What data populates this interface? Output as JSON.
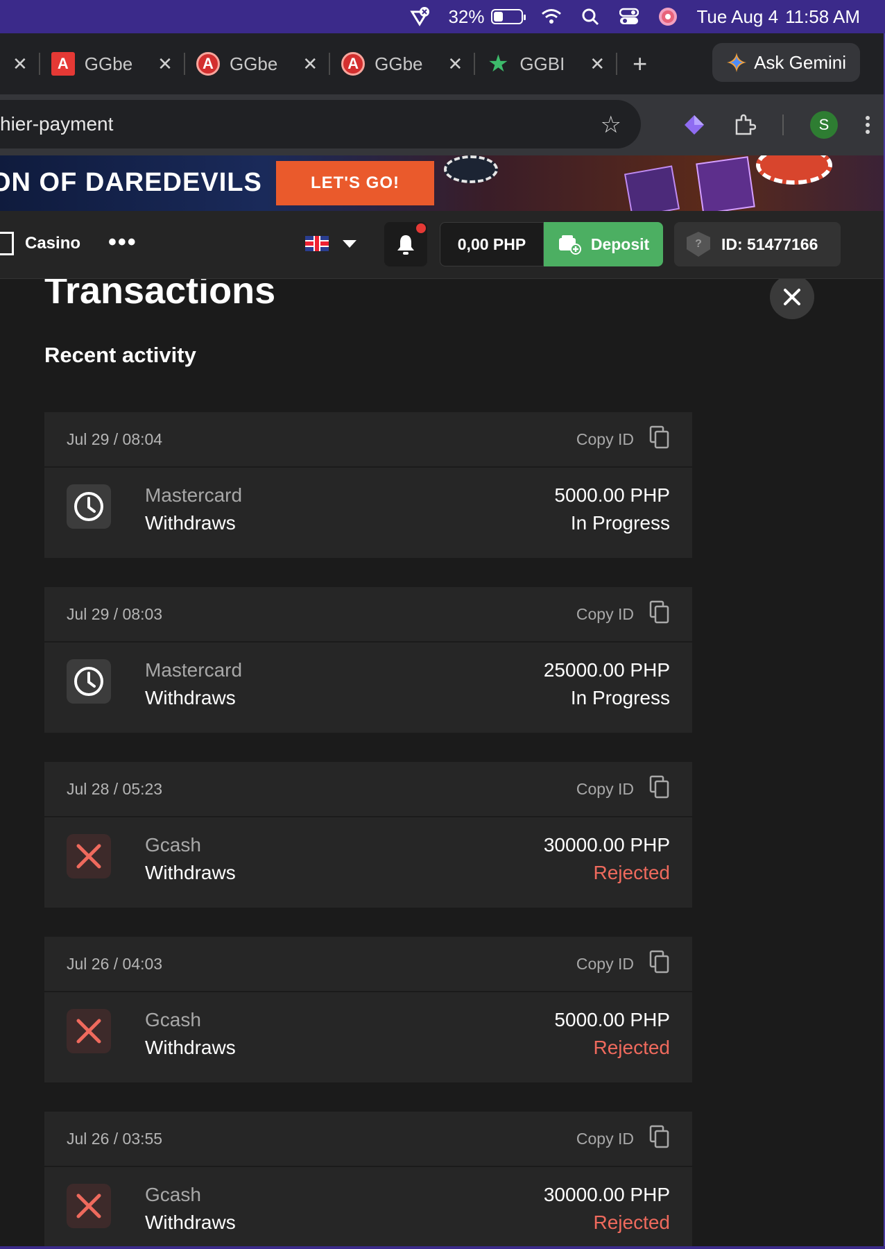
{
  "menubar": {
    "battery_percent": "32%",
    "battery_level": 0.32,
    "date": "Tue Aug 4",
    "time": "11:58 AM"
  },
  "tabs": [
    {
      "title": "GGbe",
      "favicon": "ggbet-square-icon"
    },
    {
      "title": "GGbe",
      "favicon": "ggbet-ring-icon"
    },
    {
      "title": "GGbe",
      "favicon": "ggbet-ring-icon"
    },
    {
      "title": "GGBI",
      "favicon": "green-star-icon"
    }
  ],
  "gemini": {
    "label": "Ask Gemini"
  },
  "omnibox": {
    "url": "hier-payment"
  },
  "profile": {
    "initial": "S"
  },
  "banner": {
    "headline": "ON OF DAREDEVILS",
    "cta": "LET'S GO!"
  },
  "site_header": {
    "casino_label": "Casino",
    "more_label": "•••",
    "balance": "0,00 PHP",
    "deposit_label": "Deposit",
    "user_id": "ID: 51477166"
  },
  "page": {
    "title": "Transactions",
    "section_title": "Recent activity",
    "copy_label": "Copy ID"
  },
  "transactions": [
    {
      "date": "Jul 29 / 08:04",
      "method": "Mastercard",
      "type": "Withdraws",
      "amount": "5000.00 PHP",
      "status": "In Progress",
      "state": "pending"
    },
    {
      "date": "Jul 29 / 08:03",
      "method": "Mastercard",
      "type": "Withdraws",
      "amount": "25000.00 PHP",
      "status": "In Progress",
      "state": "pending"
    },
    {
      "date": "Jul 28 / 05:23",
      "method": "Gcash",
      "type": "Withdraws",
      "amount": "30000.00 PHP",
      "status": "Rejected",
      "state": "rejected"
    },
    {
      "date": "Jul 26 / 04:03",
      "method": "Gcash",
      "type": "Withdraws",
      "amount": "5000.00 PHP",
      "status": "Rejected",
      "state": "rejected"
    },
    {
      "date": "Jul 26 / 03:55",
      "method": "Gcash",
      "type": "Withdraws",
      "amount": "30000.00 PHP",
      "status": "Rejected",
      "state": "rejected"
    }
  ],
  "colors": {
    "deposit_green": "#4caf62",
    "rejected_red": "#ef6a5d",
    "cta_orange": "#ea5a2c",
    "menubar_purple": "#3b2a8a"
  }
}
